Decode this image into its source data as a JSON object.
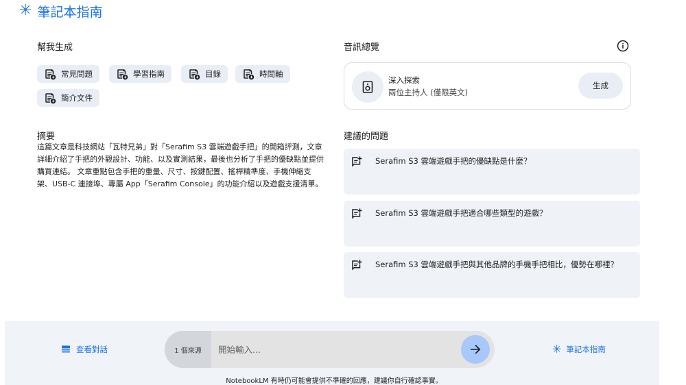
{
  "header": {
    "title": "筆記本指南",
    "icon": "sparkle-icon",
    "accent": "#1a73e8"
  },
  "help_generate": {
    "label": "幫我生成",
    "chips": [
      "常見問題",
      "學習指南",
      "目錄",
      "時間軸",
      "簡介文件"
    ]
  },
  "audio_overview": {
    "label": "音訊總覽",
    "card_title": "深入探索",
    "card_subtitle": "兩位主持人 (僅限英文)",
    "generate_label": "生成"
  },
  "summary": {
    "label": "摘要",
    "text": "這篇文章是科技網站「瓦特兄弟」對「Serafim S3 雲端遊戲手把」的開箱評測，文章詳細介紹了手把的外觀設計、功能、以及實測結果，最後也分析了手把的優缺點並提供購買連結。 文章重點包含手把的重量、尺寸、按鍵配置、搖桿精準度、手機伸縮支架、USB-C 連接埠、專屬 App「Serafim Console」的功能介紹以及遊戲支援清單。"
  },
  "suggested": {
    "label": "建議的問題",
    "questions": [
      "Serafim S3 雲端遊戲手把的優缺點是什麼？",
      "Serafim S3 雲端遊戲手把適合哪些類型的遊戲？",
      "Serafim S3 雲端遊戲手把與其他品牌的手機手把相比，優勢在哪裡？"
    ]
  },
  "bottom": {
    "view_chat_label": "查看對話",
    "source_count": "1 個來源",
    "input_placeholder": "開始輸入...",
    "guide_label": "筆記本指南",
    "disclaimer": "NotebookLM 有時仍可能會提供不準確的回應，建議你自行確認事實。"
  }
}
